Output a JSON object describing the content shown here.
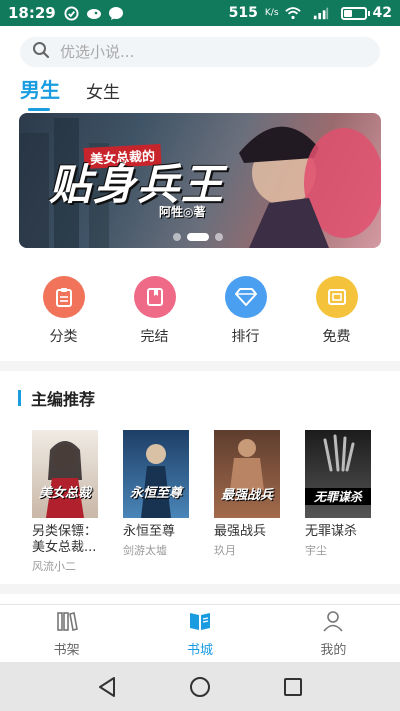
{
  "status_bar": {
    "time": "18:29",
    "net_speed": "515",
    "net_unit": "K/s",
    "battery": "42",
    "battery_fraction": 0.42
  },
  "search": {
    "placeholder": "优选小说..."
  },
  "gender_tabs": [
    {
      "label": "男生",
      "active": true
    },
    {
      "label": "女生",
      "active": false
    }
  ],
  "banner": {
    "title": "贴身兵王",
    "badge": "美女总裁的",
    "author": "阿牲◎著",
    "slides": 3,
    "active_slide": 1
  },
  "quick_links": [
    {
      "label": "分类",
      "color": "#f0735a",
      "icon": "clipboard-icon"
    },
    {
      "label": "完结",
      "color": "#ee6a86",
      "icon": "book-icon"
    },
    {
      "label": "排行",
      "color": "#4a9ff0",
      "icon": "diamond-icon"
    },
    {
      "label": "免费",
      "color": "#f5c33b",
      "icon": "tag-icon"
    }
  ],
  "section": {
    "title": "主编推荐"
  },
  "books": [
    {
      "title": "另类保镖：美女总裁...",
      "author": "风流小二",
      "cover_text": "美女总裁",
      "cover_color": "#e8e0d8"
    },
    {
      "title": "永恒至尊",
      "author": "剑游太墟",
      "cover_text": "永恒至尊",
      "cover_color": "#2f5b8c"
    },
    {
      "title": "最强战兵",
      "author": "玖月",
      "cover_text": "最强战兵",
      "cover_color": "#7a4a36"
    },
    {
      "title": "无罪谋杀",
      "author": "宇尘",
      "cover_text": "无罪谋杀",
      "cover_color": "#333333"
    }
  ],
  "bottom_nav": [
    {
      "label": "书架",
      "active": false
    },
    {
      "label": "书城",
      "active": true
    },
    {
      "label": "我的",
      "active": false
    }
  ],
  "colors": {
    "accent": "#1a9ce0",
    "status_bar": "#127a5c"
  }
}
